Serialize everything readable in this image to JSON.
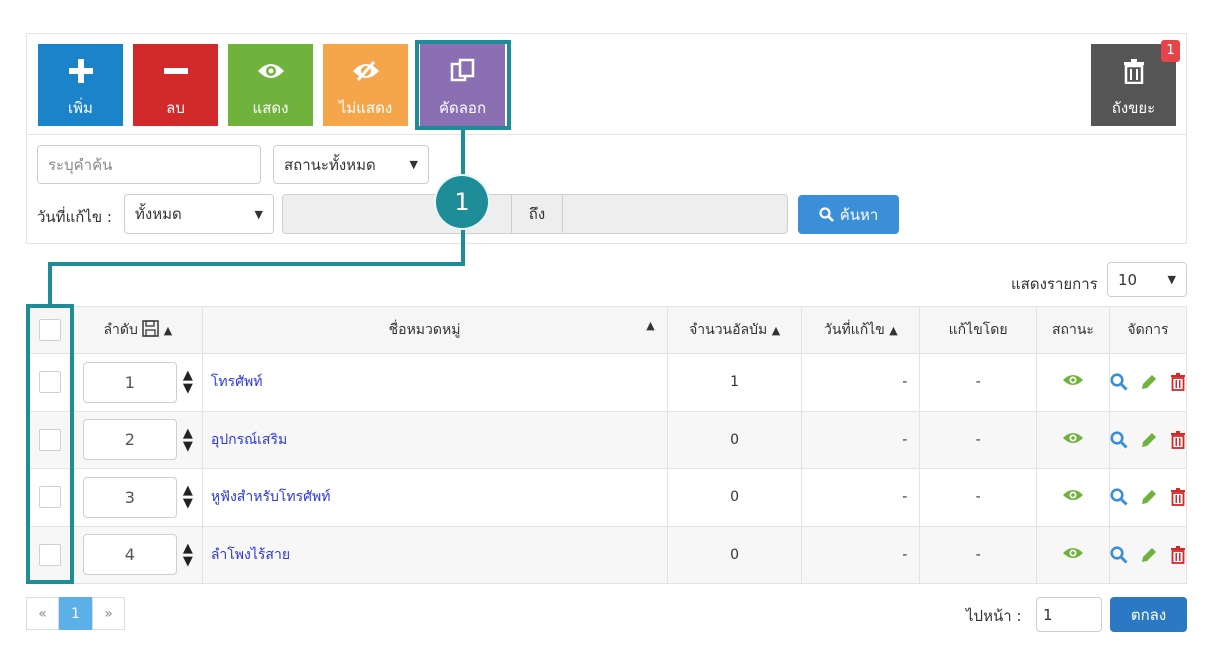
{
  "toolbar": {
    "add_label": "เพิ่ม",
    "delete_label": "ลบ",
    "show_label": "แสดง",
    "hide_label": "ไม่แสดง",
    "copy_label": "คัดลอก",
    "trash_label": "ถังขยะ",
    "trash_count": "1"
  },
  "filter": {
    "search_placeholder": "ระบุคำค้น",
    "status_select": "สถานะทั้งหมด",
    "date_label": "วันที่แก้ไข :",
    "date_select": "ทั้งหมด",
    "date_to_label": "ถึง",
    "search_button": "ค้นหา"
  },
  "callout": {
    "number": "1"
  },
  "per_page": {
    "label": "แสดงรายการ",
    "value": "10"
  },
  "table": {
    "headers": {
      "order": "ลำดับ",
      "category": "ชื่อหมวดหมู่",
      "album_count": "จำนวนอัลบัม",
      "modified_date": "วันที่แก้ไข",
      "modified_by": "แก้ไขโดย",
      "status": "สถานะ",
      "actions": "จัดการ"
    },
    "rows": [
      {
        "order": "1",
        "name": "โทรศัพท์",
        "albums": "1",
        "date": "-",
        "by": "-"
      },
      {
        "order": "2",
        "name": "อุปกรณ์เสริม",
        "albums": "0",
        "date": "-",
        "by": "-"
      },
      {
        "order": "3",
        "name": "หูฟังสำหรับโทรศัพท์",
        "albums": "0",
        "date": "-",
        "by": "-"
      },
      {
        "order": "4",
        "name": "ลำโพงไร้สาย",
        "albums": "0",
        "date": "-",
        "by": "-"
      }
    ]
  },
  "pagination": {
    "prev": "«",
    "current": "1",
    "next": "»",
    "goto_label": "ไปหน้า :",
    "goto_value": "1",
    "ok_button": "ตกลง"
  },
  "colors": {
    "accent": "#1f8d98",
    "add": "#1a83c9",
    "delete": "#d22a2a",
    "show": "#6fb33d",
    "hide": "#f5a64a",
    "copy": "#8a6fb3",
    "trash": "#555555"
  }
}
